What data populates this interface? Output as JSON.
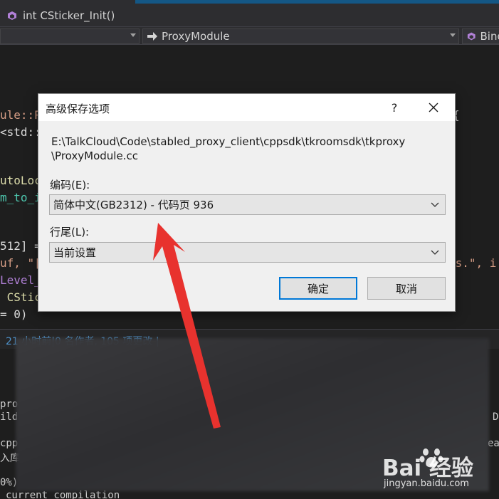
{
  "ide": {
    "function_tab": "int CSticker_Init()",
    "scope_combo": "",
    "module_combo": "ProxyModule",
    "right_combo": "Bind",
    "code_lines": [
      {
        "text": "ule::P",
        "tail": "{"
      },
      {
        "text": "<std::"
      },
      {
        "text": "utoLoc"
      },
      {
        "text": "m_to_i"
      },
      {
        "text": "512] =",
        "tail": ""
      },
      {
        "text": "uf, \"[",
        "tail": "%s.\", i"
      },
      {
        "text": "Level_"
      },
      {
        "text": " CStic"
      },
      {
        "text": "= 0)"
      }
    ],
    "status_text": "21 小时前|0 名作者, 105 项更改 | ",
    "output_lines": [
      "pro",
      "ild",
      "cpp",
      "入库",
      "0%)",
      "current compilation"
    ],
    "output_right": [
      "D",
      "ea"
    ]
  },
  "dialog": {
    "title": "高级保存选项",
    "help_label": "?",
    "path_line1": "E:\\TalkCloud\\Code\\stabled_proxy_client\\cppsdk\\tkroomsdk\\tkproxy",
    "path_line2": "\\ProxyModule.cc",
    "encoding_label": "编码(E):",
    "encoding_value": "简体中文(GB2312) - 代码页 936",
    "line_ending_label": "行尾(L):",
    "line_ending_value": "当前设置",
    "ok_label": "确定",
    "cancel_label": "取消"
  },
  "watermark": {
    "brand": "Bai 经验",
    "url": "jingyan.baidu.com"
  },
  "colors": {
    "accent": "#0078d7",
    "arrow": "#e8322e",
    "ide_bg": "#1e1e1e"
  }
}
